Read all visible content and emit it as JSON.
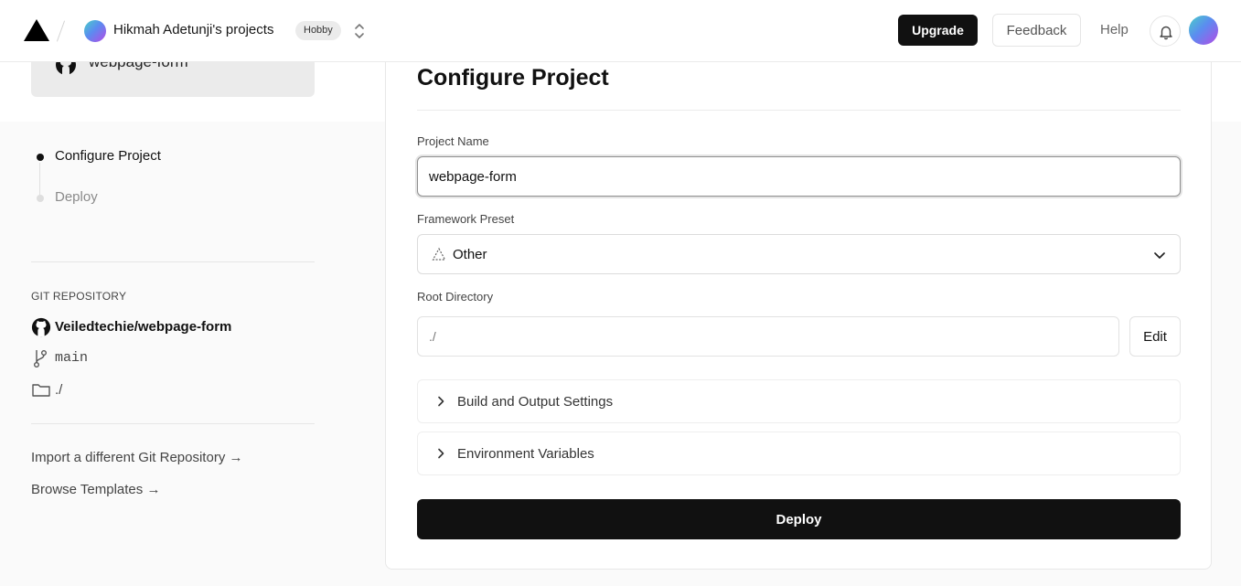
{
  "header": {
    "team_name": "Hikmah Adetunji's projects",
    "plan_badge": "Hobby",
    "upgrade_label": "Upgrade",
    "feedback_label": "Feedback",
    "help_label": "Help"
  },
  "repo_card": {
    "name": "webpage-form"
  },
  "steps": [
    {
      "label": "Configure Project",
      "active": true
    },
    {
      "label": "Deploy",
      "active": false
    }
  ],
  "git": {
    "section_label": "GIT REPOSITORY",
    "repo": "Veiledtechie/webpage-form",
    "branch": "main",
    "directory": "./"
  },
  "links": {
    "import_git": "Import a different Git Repository →",
    "browse_templates": "Browse Templates →"
  },
  "form": {
    "title": "Configure Project",
    "project_name_label": "Project Name",
    "project_name_value": "webpage-form",
    "framework_label": "Framework Preset",
    "framework_value": "Other",
    "root_dir_label": "Root Directory",
    "root_dir_placeholder": "./",
    "edit_label": "Edit",
    "build_settings_label": "Build and Output Settings",
    "env_vars_label": "Environment Variables",
    "deploy_label": "Deploy"
  },
  "colors": {
    "primary": "#111111",
    "active_step": "#111111",
    "inactive_step": "#d0d0d0"
  }
}
